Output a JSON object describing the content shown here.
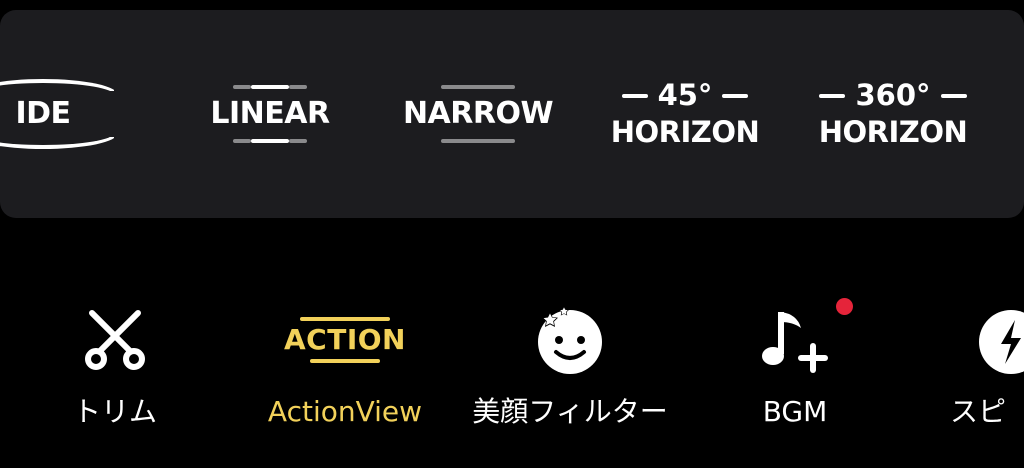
{
  "lens_modes": [
    {
      "id": "wide",
      "label": "IDE"
    },
    {
      "id": "linear",
      "label": "LINEAR"
    },
    {
      "id": "narrow",
      "label": "NARROW"
    },
    {
      "id": "horizon45",
      "degree": "45°",
      "label": "HORIZON"
    },
    {
      "id": "horizon360",
      "degree": "360°",
      "label": "HORIZON"
    }
  ],
  "tools": [
    {
      "id": "trim",
      "label": "トリム",
      "icon": "scissors-icon"
    },
    {
      "id": "actionview",
      "label": "ActionView",
      "icon": "action-icon",
      "icon_text": "ACTION",
      "active": true
    },
    {
      "id": "beauty",
      "label": "美顔フィルター",
      "icon": "beauty-face-icon"
    },
    {
      "id": "bgm",
      "label": "BGM",
      "icon": "music-add-icon",
      "badge": true
    },
    {
      "id": "speed",
      "label": "スピ",
      "icon": "speed-icon"
    }
  ],
  "colors": {
    "panel": "#1c1c1f",
    "active": "#f2d15a",
    "badge": "#e5243a",
    "bar_dim": "#8a8a8c"
  }
}
